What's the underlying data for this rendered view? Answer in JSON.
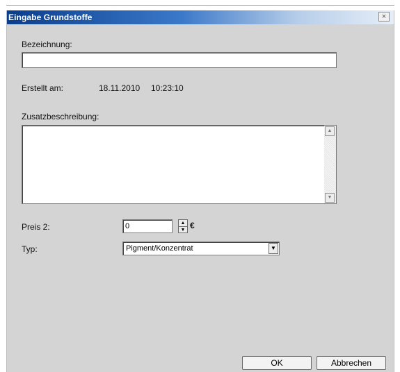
{
  "dialog": {
    "title": "Eingabe Grundstoffe",
    "close_glyph": "×"
  },
  "form": {
    "bezeichnung_label": "Bezeichnung:",
    "bezeichnung_value": "",
    "erstellt_label": "Erstellt am:",
    "erstellt_date": "18.11.2010",
    "erstellt_time": "10:23:10",
    "zusatz_label": "Zusatzbeschreibung:",
    "zusatz_value": "",
    "preis_label": "Preis 2:",
    "preis_value": "0",
    "currency": "€",
    "typ_label": "Typ:",
    "typ_value": "Pigment/Konzentrat"
  },
  "buttons": {
    "ok": "OK",
    "cancel": "Abbrechen"
  },
  "colors": {
    "title_gradient_start": "#0a3e8c",
    "title_gradient_end": "#e6eef8",
    "dialog_bg": "#d4d4d4"
  }
}
